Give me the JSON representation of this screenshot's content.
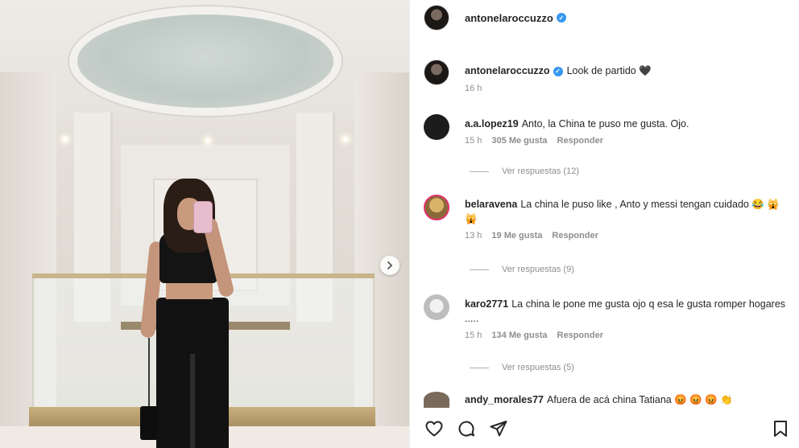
{
  "post": {
    "author": "antonelaroccuzzo",
    "verified_mark": "✓"
  },
  "caption": {
    "user": "antonelaroccuzzo",
    "text": "Look de partido 🖤",
    "time": "16 h"
  },
  "comments": [
    {
      "user": "a.a.lopez19",
      "text": "Anto, la China te puso me gusta. Ojo.",
      "time": "15 h",
      "likes": "305 Me gusta",
      "reply_label": "Responder",
      "view_replies": "Ver respuestas (12)",
      "avatar_color": "#1c1c1c"
    },
    {
      "user": "belaravena",
      "text": "La china le puso like , Anto y messi tengan cuidado 😂 🙀 🙀",
      "time": "13 h",
      "likes": "19 Me gusta",
      "reply_label": "Responder",
      "view_replies": "Ver respuestas (9)",
      "avatar_color": "#c9a45a"
    },
    {
      "user": "karo2771",
      "text": "La china le pone me gusta ojo q esa le gusta romper hogares .....",
      "time": "15 h",
      "likes": "134 Me gusta",
      "reply_label": "Responder",
      "view_replies": "Ver respuestas (5)",
      "avatar_color": "#d8d8d8"
    },
    {
      "user": "andy_morales77",
      "text": "Afuera de acá china Tatiana 😡 😡 😡 👏",
      "avatar_color": "#7a6a5c"
    }
  ],
  "icons": {
    "like": "heart-icon",
    "comment": "comment-icon",
    "share": "send-icon",
    "save": "bookmark-icon",
    "next": "chevron-right-icon"
  },
  "colors": {
    "verified": "#3797f0",
    "muted": "#8e8e8e",
    "text": "#262626"
  }
}
